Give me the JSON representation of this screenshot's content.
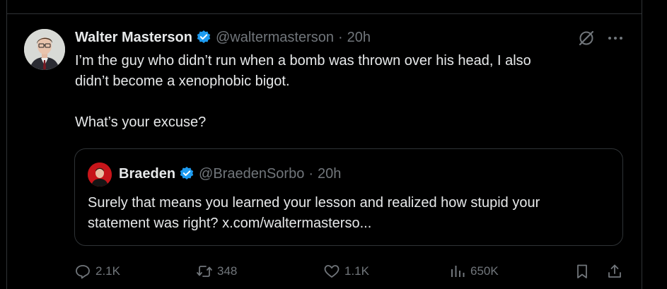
{
  "tweet": {
    "author_name": "Walter Masterson",
    "handle": "@waltermasterson",
    "separator": "·",
    "time": "20h",
    "text_line1": "I’m the guy who didn’t run when a bomb was thrown over his head, I also",
    "text_line2": "didn’t become a xenophobic bigot.",
    "text_line3": "What’s your excuse?"
  },
  "quote": {
    "author_name": "Braeden",
    "handle": "@BraedenSorbo",
    "separator": "·",
    "time": "20h",
    "text_line1": "Surely that means you learned your lesson and realized how stupid your",
    "text_line2": "statement was right? x.com/waltermasterso..."
  },
  "actions": {
    "replies": "2.1K",
    "reposts": "348",
    "likes": "1.1K",
    "views": "650K"
  },
  "colors": {
    "background": "#000000",
    "text": "#e7e9ea",
    "muted": "#71767b",
    "verified": "#1d9bf0",
    "border": "#2f3336"
  }
}
